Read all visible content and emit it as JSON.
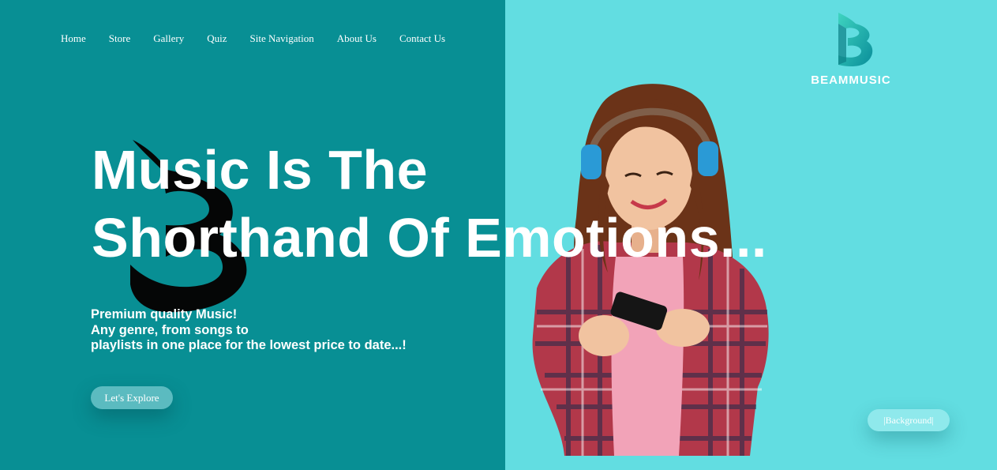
{
  "nav": {
    "items": [
      {
        "label": "Home"
      },
      {
        "label": "Store"
      },
      {
        "label": "Gallery"
      },
      {
        "label": "Quiz"
      },
      {
        "label": "Site Navigation"
      },
      {
        "label": "About Us"
      },
      {
        "label": "Contact Us"
      }
    ]
  },
  "hero": {
    "headline_line1": "Music Is The",
    "headline_line2": "Shorthand Of Emotions...",
    "tagline": [
      "Premium quality Music!",
      "Any genre, from songs to",
      "playlists in one place for the lowest price to date...!"
    ],
    "cta_label": "Let's Explore"
  },
  "brand": {
    "logo_text": "BEAMMUSIC"
  },
  "background_toggle": {
    "label": "|Background|"
  },
  "colors": {
    "left_panel": "#088f94",
    "right_panel": "#62dde1",
    "text": "#ffffff"
  }
}
